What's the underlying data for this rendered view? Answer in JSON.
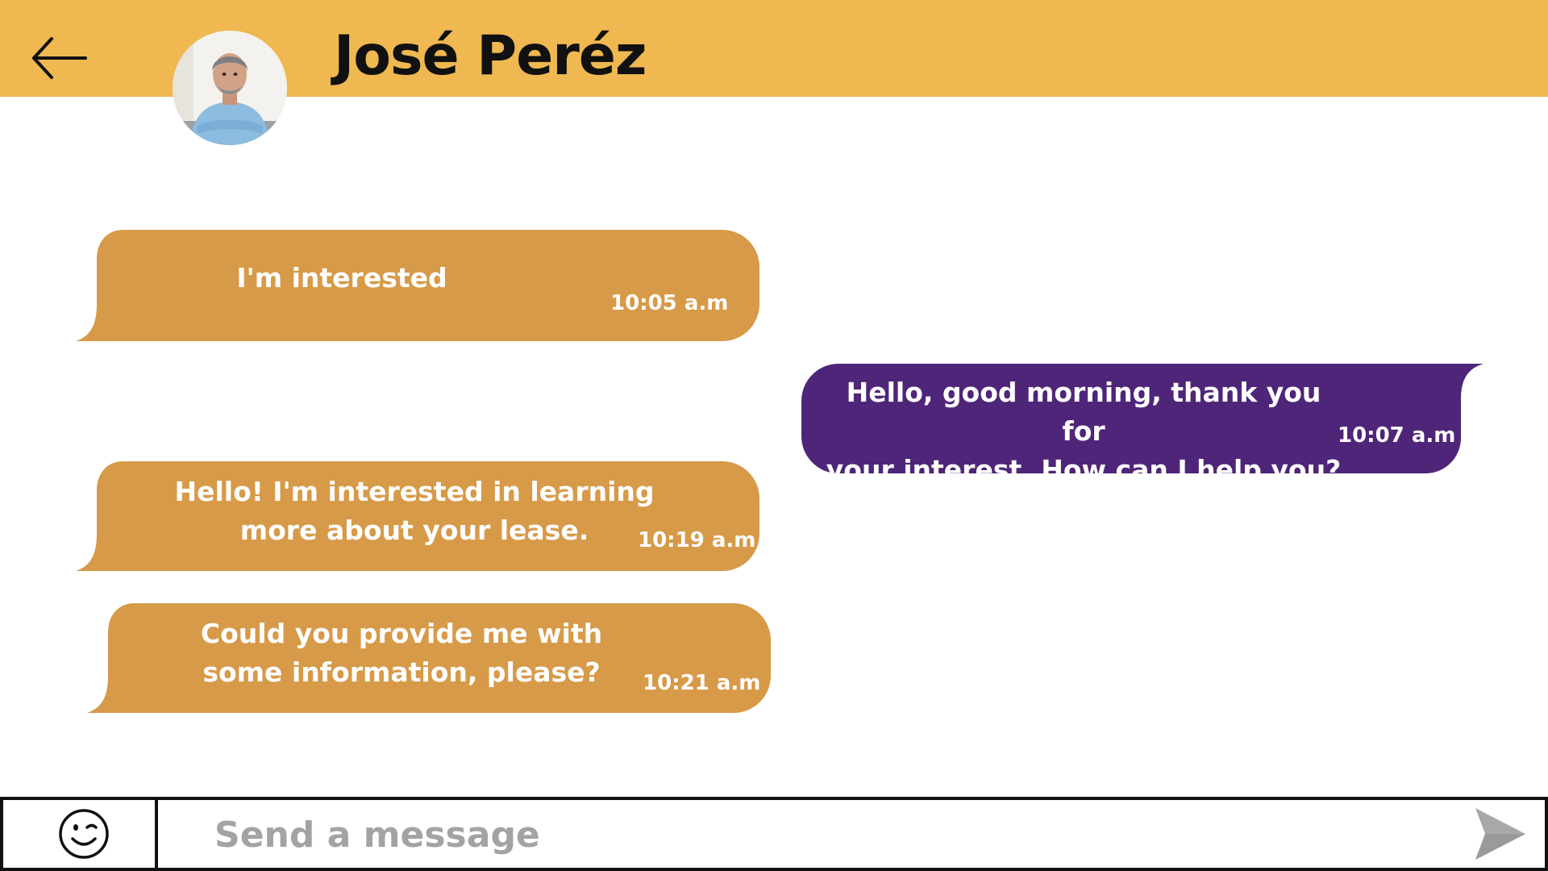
{
  "header": {
    "contact_name": "José Peréz",
    "background_color": "#efb850"
  },
  "messages": [
    {
      "direction": "incoming",
      "text": "I'm interested",
      "time": "10:05 a.m",
      "color": "#d79a48"
    },
    {
      "direction": "outgoing",
      "text": "Hello, good morning, thank you for\nyour interest. How can I help you?",
      "time": "10:07 a.m",
      "color": "#4f2579"
    },
    {
      "direction": "incoming",
      "text": "Hello! I'm interested in learning\nmore about your lease.",
      "time": "10:19 a.m",
      "color": "#d79a48"
    },
    {
      "direction": "incoming",
      "text": "Could you provide me with\nsome information, please?",
      "time": "10:21 a.m",
      "color": "#d79a48"
    }
  ],
  "composer": {
    "placeholder": "Send a message",
    "value": "",
    "emoji_icon": "smiley-face-icon",
    "send_icon": "send-arrow-icon"
  }
}
